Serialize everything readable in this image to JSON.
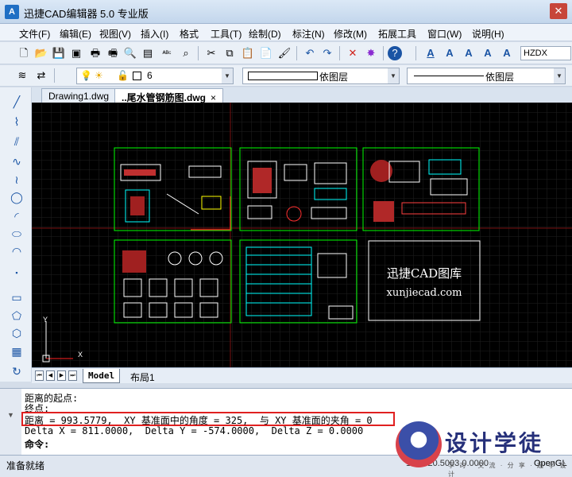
{
  "app": {
    "title": "迅捷CAD编辑器 5.0 专业版",
    "icon_label": "A",
    "close_glyph": "✕"
  },
  "menu": {
    "items": [
      "文件(F)",
      "编辑(E)",
      "视图(V)",
      "插入(I)",
      "格式",
      "工具(T)",
      "绘制(D)",
      "标注(N)",
      "修改(M)",
      "拓展工具",
      "窗口(W)",
      "说明(H)"
    ]
  },
  "toolbar": {
    "font_value": "HZDX"
  },
  "layer_bar": {
    "layer_number": "6",
    "linetype_label": "依图层",
    "lineweight_label": "依图层"
  },
  "doc_tabs": [
    {
      "label": "Drawing1.dwg"
    },
    {
      "label": "..尾水管钢筋图.dwg"
    }
  ],
  "canvas": {
    "watermark_line1": "迅捷CAD图库",
    "watermark_line2": "xunjiecad.com",
    "axis_x": "X",
    "axis_y": "Y"
  },
  "layout_tabs": {
    "model": "Model",
    "layout1": "布局1"
  },
  "command": {
    "line1": "距离的起点:",
    "line2": "终点:",
    "line3": "距离 = 993.5779,  XY 基准面中的角度 = 325,  与 XY 基准面的夹角 = 0",
    "line4": "Delta X = 811.0000,  Delta Y = -574.0000,  Delta Z = 0.0000",
    "prompt": "命令:"
  },
  "status": {
    "text": "准备就绪",
    "coords": "1.8... 20.5003,0.0000",
    "renderer": "OpenGL"
  },
  "logo": {
    "text": "设计学徒",
    "sub": "学 习 · 交 流 · 分 享 · 起 学 设 计"
  },
  "colors": {
    "canvas_bg": "#000000",
    "drawing_frame": "#00ff00",
    "highlight": "#e02020"
  }
}
